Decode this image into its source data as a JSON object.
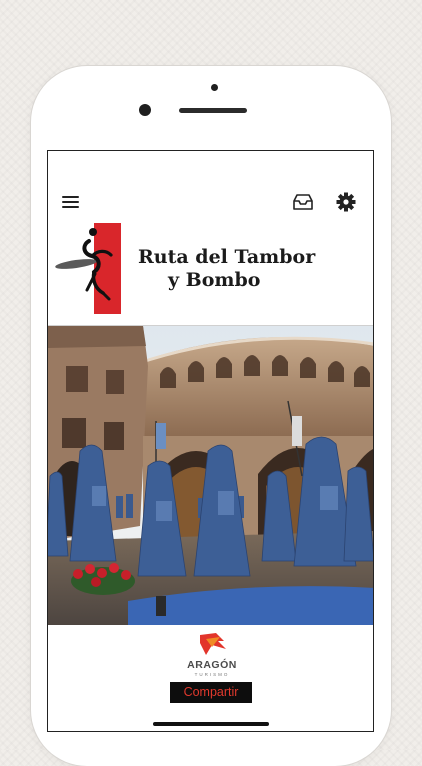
{
  "app": {
    "logo": {
      "line1": "Ruta del Tambor",
      "line2": "y Bombo",
      "accent_color": "#d9262b"
    },
    "share_button_label": "Compartir",
    "footer": {
      "brand": "ARAGÓN",
      "brand_sub": "TURISMO"
    },
    "hero": {
      "subject": "drummers in blue robes at a bullring"
    }
  },
  "icons": {
    "menu": "hamburger-menu-icon",
    "inbox": "inbox-icon",
    "settings": "gear-icon"
  },
  "colors": {
    "robe_blue": "#3d5f96",
    "arena_stone": "#a7866a",
    "share_bg": "#0d0d0d",
    "share_text": "#e0392d"
  }
}
